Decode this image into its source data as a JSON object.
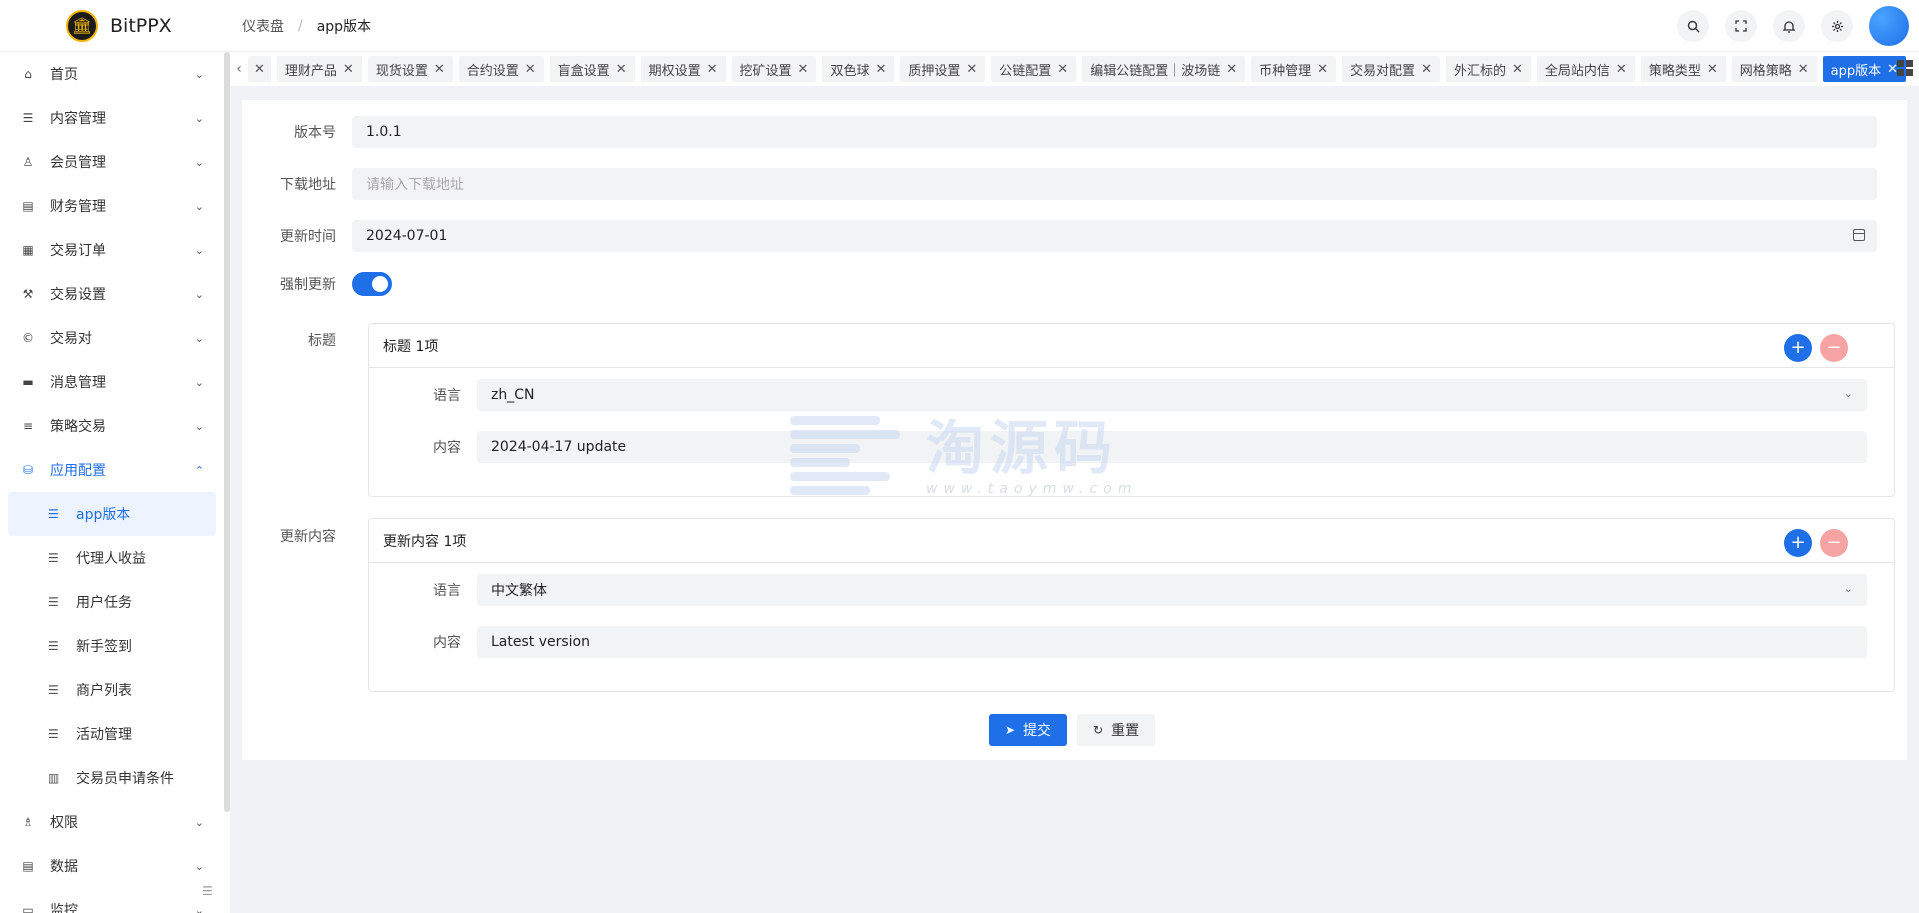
{
  "header": {
    "brand": "BitPPX",
    "breadcrumb": [
      "仪表盘",
      "/",
      "app版本"
    ],
    "actions": [
      "search-icon",
      "fullscreen-icon",
      "bell-icon",
      "settings-icon",
      "avatar"
    ]
  },
  "sidebar": {
    "items": [
      {
        "label": "首页",
        "icon": "home-icon"
      },
      {
        "label": "内容管理",
        "icon": "list-icon"
      },
      {
        "label": "会员管理",
        "icon": "user-icon"
      },
      {
        "label": "财务管理",
        "icon": "ledger-icon"
      },
      {
        "label": "交易订单",
        "icon": "table-icon"
      },
      {
        "label": "交易设置",
        "icon": "wrench-icon"
      },
      {
        "label": "交易对",
        "icon": "copyright-icon"
      },
      {
        "label": "消息管理",
        "icon": "message-icon"
      },
      {
        "label": "策略交易",
        "icon": "menu-icon"
      },
      {
        "label": "应用配置",
        "icon": "database-icon"
      }
    ],
    "subitems": [
      {
        "label": "app版本"
      },
      {
        "label": "代理人收益"
      },
      {
        "label": "用户任务"
      },
      {
        "label": "新手签到"
      },
      {
        "label": "商户列表"
      },
      {
        "label": "活动管理"
      },
      {
        "label": "交易员申请条件"
      }
    ],
    "bottom_items": [
      {
        "label": "权限",
        "icon": "permission-icon"
      },
      {
        "label": "数据",
        "icon": "data-icon"
      },
      {
        "label": "监控",
        "icon": "monitor-icon"
      }
    ]
  },
  "tabs": [
    "理财产品",
    "现货设置",
    "合约设置",
    "盲盒设置",
    "期权设置",
    "挖矿设置",
    "双色球",
    "质押设置",
    "公链配置",
    "编辑公链配置｜波场链",
    "币种管理",
    "交易对配置",
    "外汇标的",
    "全局站内信",
    "策略类型",
    "网格策略",
    "app版本"
  ],
  "form": {
    "version_label": "版本号",
    "version_value": "1.0.1",
    "download_label": "下载地址",
    "download_placeholder": "请输入下载地址",
    "update_time_label": "更新时间",
    "update_time_value": "2024-07-01",
    "force_update_label": "强制更新",
    "force_update_on": true,
    "title_label": "标题",
    "title_group": {
      "header": "标题 1项",
      "lang_label": "语言",
      "lang_value": "zh_CN",
      "content_label": "内容",
      "content_value": "2024-04-17 update"
    },
    "content_group_label": "更新内容",
    "content_group": {
      "header": "更新内容 1项",
      "lang_label": "语言",
      "lang_value": "中文繁体",
      "content_label": "内容",
      "content_value": "Latest version"
    },
    "submit_label": "提交",
    "reset_label": "重置"
  },
  "watermark": {
    "text": "淘源码",
    "url": "www.taoymw.com"
  },
  "colors": {
    "accent": "#1e6fe8",
    "remove": "#f5a3a3"
  }
}
